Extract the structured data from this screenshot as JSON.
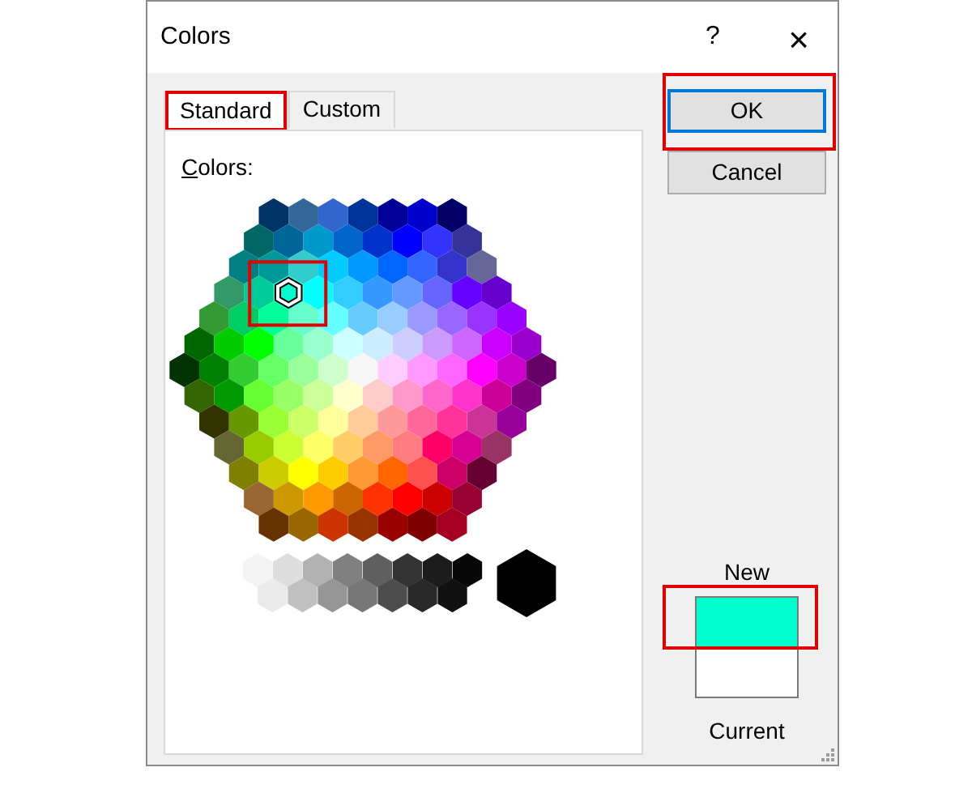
{
  "window": {
    "title": "Colors",
    "help": "?",
    "close": "×"
  },
  "tabs": [
    {
      "label": "Standard",
      "selected": true,
      "highlighted": true
    },
    {
      "label": "Custom",
      "selected": false,
      "highlighted": false
    }
  ],
  "palette_label": "Colors:",
  "palette": {
    "selection_highlighted": true,
    "rows": [
      [
        {
          "selected": false
        },
        {
          "selected": false
        },
        {
          "selected": false
        },
        {
          "selected": false
        },
        {
          "selected": false
        },
        {
          "selected": false
        },
        {
          "selected": false
        }
      ],
      [
        {
          "selected": false
        },
        {
          "selected": false
        },
        {
          "selected": false
        },
        {
          "selected": false
        },
        {
          "selected": false
        },
        {
          "selected": false
        },
        {
          "selected": false
        },
        {
          "selected": false
        }
      ],
      [
        {
          "selected": false
        },
        {
          "selected": false
        },
        {
          "selected": false
        },
        {
          "selected": false
        },
        {
          "selected": false
        },
        {
          "selected": false
        },
        {
          "selected": false
        },
        {
          "selected": false
        },
        {
          "selected": false
        }
      ],
      [
        {
          "selected": false
        },
        {
          "selected": false
        },
        {
          "selected": true
        },
        {
          "selected": false
        },
        {
          "selected": false
        },
        {
          "selected": false
        },
        {
          "selected": false
        },
        {
          "selected": false
        },
        {
          "selected": false
        },
        {
          "selected": false
        }
      ],
      [
        {
          "selected": false
        },
        {
          "selected": false
        },
        {
          "selected": false
        },
        {
          "selected": false
        },
        {
          "selected": false
        },
        {
          "selected": false
        },
        {
          "selected": false
        },
        {
          "selected": false
        },
        {
          "selected": false
        },
        {
          "selected": false
        },
        {
          "selected": false
        }
      ],
      [
        {
          "selected": false
        },
        {
          "selected": false
        },
        {
          "selected": false
        },
        {
          "selected": false
        },
        {
          "selected": false
        },
        {
          "selected": false
        },
        {
          "selected": false
        },
        {
          "selected": false
        },
        {
          "selected": false
        },
        {
          "selected": false
        },
        {
          "selected": false
        },
        {
          "selected": false
        }
      ],
      [
        {
          "selected": false
        },
        {
          "selected": false
        },
        {
          "selected": false
        },
        {
          "selected": false
        },
        {
          "selected": false
        },
        {
          "selected": false
        },
        {
          "selected": false
        },
        {
          "selected": false
        },
        {
          "selected": false
        },
        {
          "selected": false
        },
        {
          "selected": false
        },
        {
          "selected": false
        },
        {
          "selected": false
        }
      ],
      [
        {
          "selected": false
        },
        {
          "selected": false
        },
        {
          "selected": false
        },
        {
          "selected": false
        },
        {
          "selected": false
        },
        {
          "selected": false
        },
        {
          "selected": false
        },
        {
          "selected": false
        },
        {
          "selected": false
        },
        {
          "selected": false
        },
        {
          "selected": false
        },
        {
          "selected": false
        }
      ],
      [
        {
          "selected": false
        },
        {
          "selected": false
        },
        {
          "selected": false
        },
        {
          "selected": false
        },
        {
          "selected": false
        },
        {
          "selected": false
        },
        {
          "selected": false
        },
        {
          "selected": false
        },
        {
          "selected": false
        },
        {
          "selected": false
        },
        {
          "selected": false
        }
      ],
      [
        {
          "selected": false
        },
        {
          "selected": false
        },
        {
          "selected": false
        },
        {
          "selected": false
        },
        {
          "selected": false
        },
        {
          "selected": false
        },
        {
          "selected": false
        },
        {
          "selected": false
        },
        {
          "selected": false
        },
        {
          "selected": false
        }
      ],
      [
        {
          "selected": false
        },
        {
          "selected": false
        },
        {
          "selected": false
        },
        {
          "selected": false
        },
        {
          "selected": false
        },
        {
          "selected": false
        },
        {
          "selected": false
        },
        {
          "selected": false
        },
        {
          "selected": false
        }
      ],
      [
        {
          "selected": false
        },
        {
          "selected": false
        },
        {
          "selected": false
        },
        {
          "selected": false
        },
        {
          "selected": false
        },
        {
          "selected": false
        },
        {
          "selected": false
        },
        {
          "selected": false
        }
      ],
      [
        {
          "selected": false
        },
        {
          "selected": false
        },
        {
          "selected": false
        },
        {
          "selected": false
        },
        {
          "selected": false
        },
        {
          "selected": false
        },
        {
          "selected": false
        }
      ]
    ]
  },
  "grays": [
    [
      {
        "selected": false
      },
      {
        "selected": false
      },
      {
        "selected": false
      },
      {
        "selected": false
      },
      {
        "selected": false
      },
      {
        "selected": false
      },
      {
        "selected": false
      },
      {
        "selected": false
      }
    ],
    [
      {
        "selected": false
      },
      {
        "selected": false
      },
      {
        "selected": false
      },
      {
        "selected": false
      },
      {
        "selected": false
      },
      {
        "selected": false
      },
      {
        "selected": false
      }
    ]
  ],
  "large_swatch": {
    "selected": false
  },
  "buttons": [
    {
      "label": "OK",
      "default": true,
      "highlighted": true
    },
    {
      "label": "Cancel",
      "default": false,
      "highlighted": false
    }
  ],
  "preview": {
    "new": {
      "label": "New",
      "color": "#00ffcc",
      "highlighted": true
    },
    "current": {
      "label": "Current",
      "color": "#ffffff"
    }
  }
}
